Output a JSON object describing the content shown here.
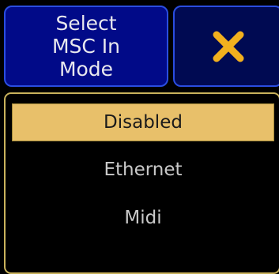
{
  "dialog": {
    "title_lines": [
      "Select",
      "MSC In",
      "Mode"
    ],
    "close_icon": "close-icon",
    "accent_color": "#e8c06a",
    "title_bg": "#010a88"
  },
  "options": {
    "selected": "Disabled",
    "items": [
      {
        "label": "Disabled",
        "selected": true
      },
      {
        "label": "Ethernet",
        "selected": false
      },
      {
        "label": "Midi",
        "selected": false
      }
    ]
  }
}
